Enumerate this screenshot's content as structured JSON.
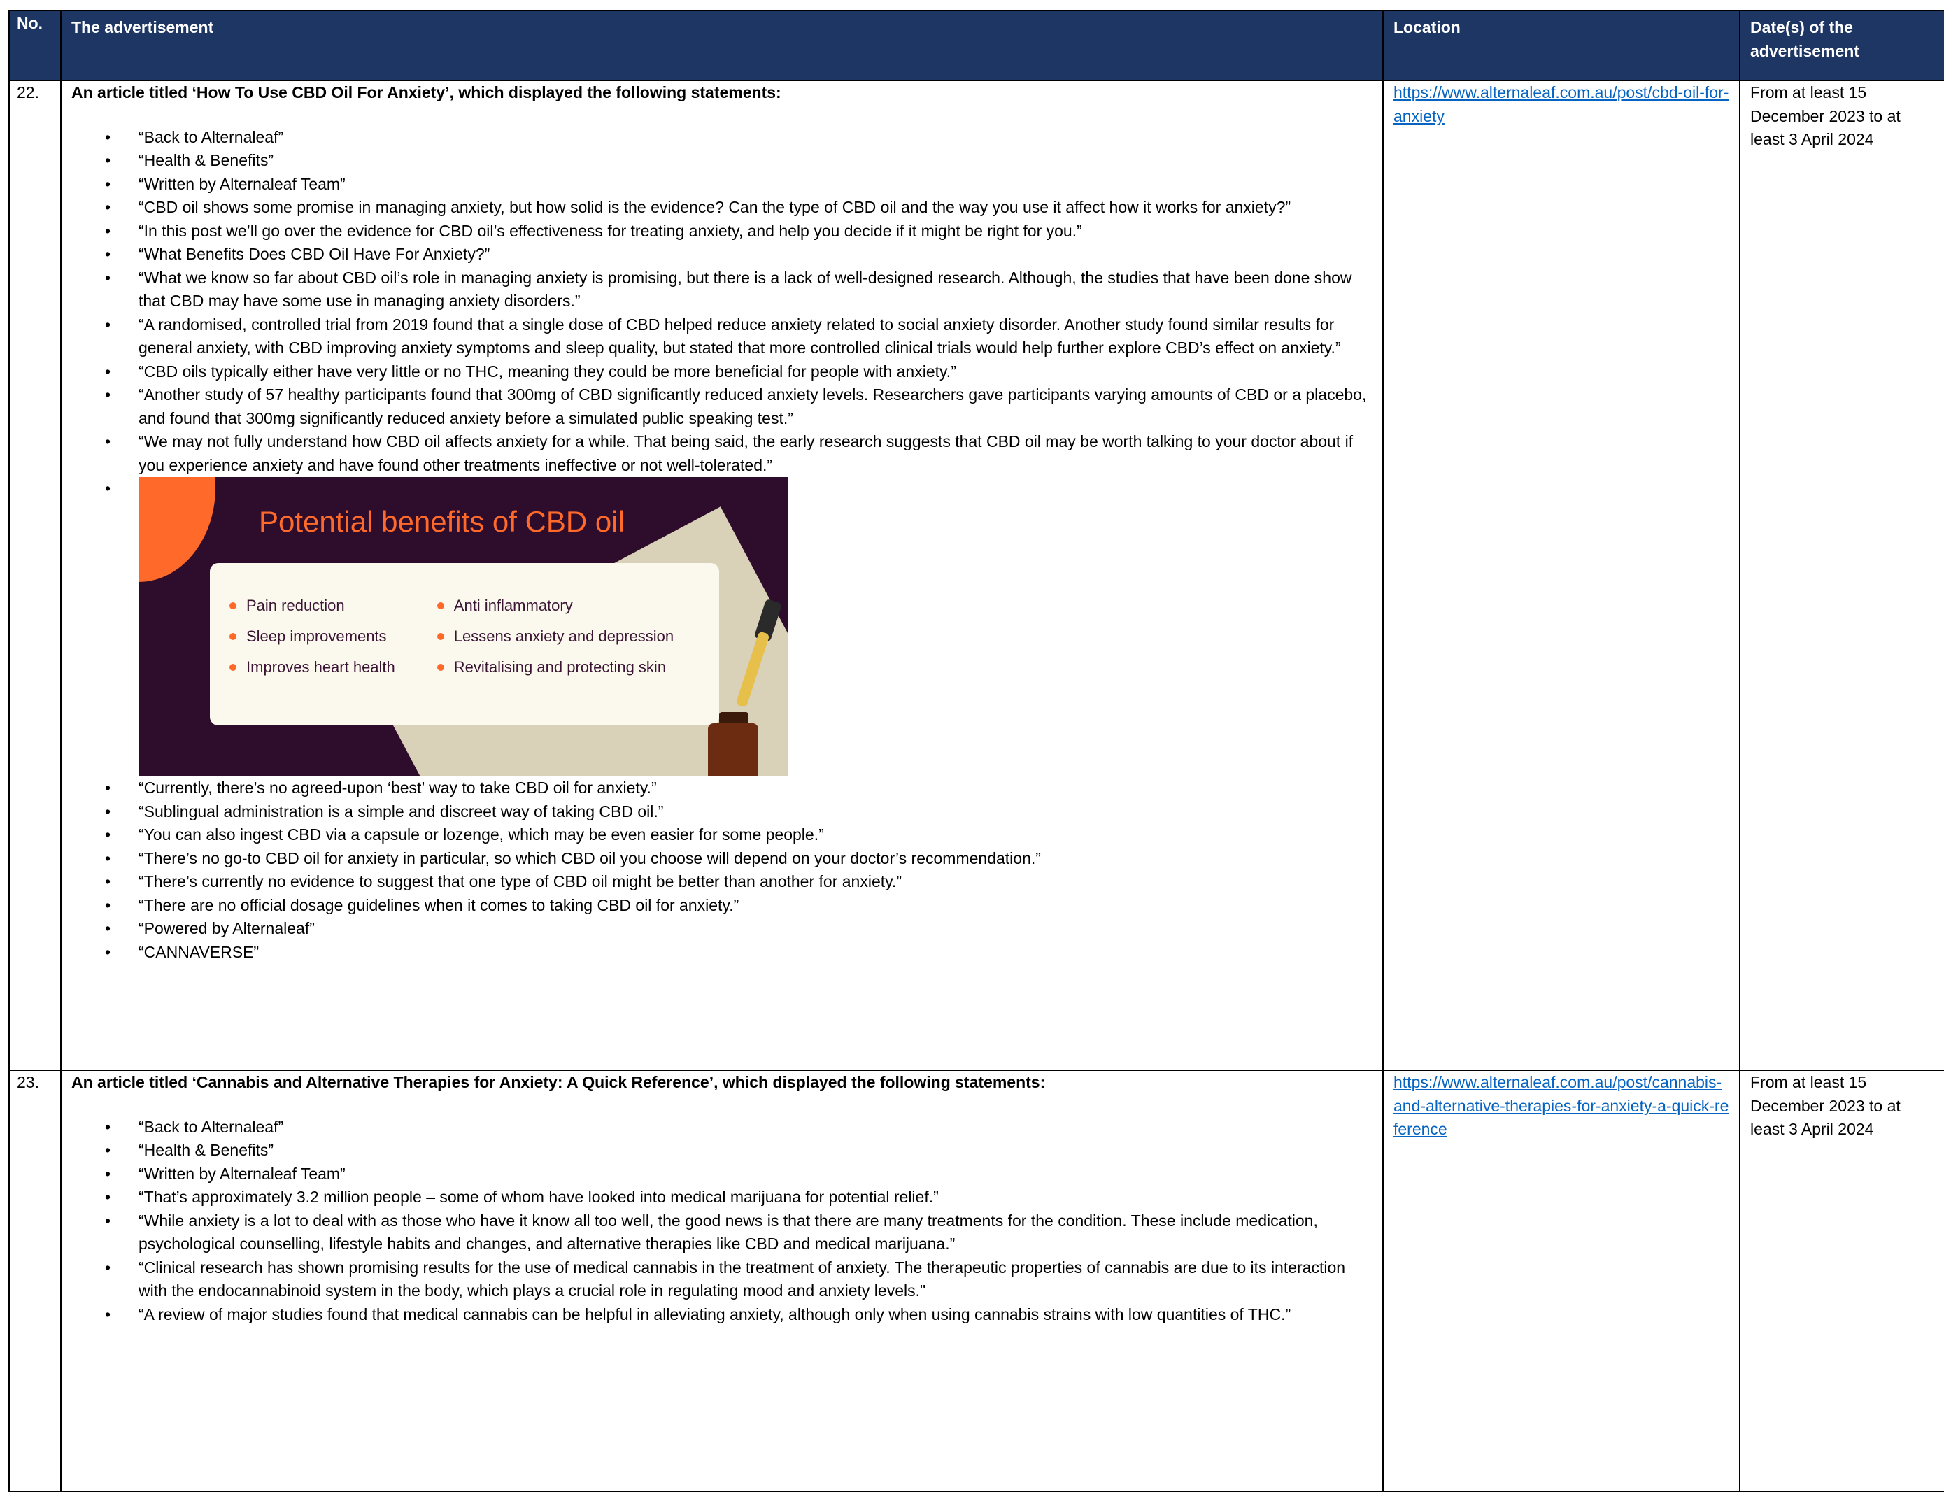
{
  "header": {
    "no": "No.",
    "advertisement": "The advertisement",
    "location": "Location",
    "dates": "Date(s) of the advertisement"
  },
  "rows": [
    {
      "no": "22.",
      "intro": "An article titled ‘How To Use CBD Oil For Anxiety’, which displayed the following statements:",
      "statements_before": [
        "“Back to Alternaleaf”",
        "“Health & Benefits”",
        "“Written by Alternaleaf Team”",
        "“CBD oil shows some promise in managing anxiety, but how solid is the evidence? Can the type of CBD oil and the way you use it affect how it works for anxiety?”",
        "“In this post we’ll go over the evidence for CBD oil’s effectiveness for treating anxiety, and help you decide if it might be right for you.”",
        "“What Benefits Does CBD Oil Have For Anxiety?”",
        "“What we know so far about CBD oil’s role in managing anxiety is promising, but there is a lack of well-designed research. Although, the studies that have been done show that CBD may have some use in managing anxiety disorders.”",
        "“A randomised, controlled trial from 2019 found that a single dose of CBD helped reduce anxiety related to social anxiety disorder. Another study found similar results for general anxiety, with CBD improving anxiety symptoms and sleep quality, but stated that more controlled clinical trials would help further explore CBD’s effect on anxiety.”",
        "“CBD oils typically either have very little or no THC, meaning they could be more beneficial for people with anxiety.”",
        "“Another study of 57 healthy participants found that 300mg of CBD significantly reduced anxiety levels. Researchers gave participants varying amounts of CBD or a placebo, and found that 300mg significantly reduced anxiety before a simulated public speaking test.”",
        "“We may not fully understand how CBD oil affects anxiety for a while. That being said, the early research suggests that CBD oil may be worth talking to your doctor about if you experience anxiety and have found other treatments ineffective or not well-tolerated.”"
      ],
      "image": {
        "title": "Potential benefits of CBD oil",
        "left_items": [
          "Pain reduction",
          "Sleep improvements",
          "Improves heart health"
        ],
        "right_items": [
          "Anti inflammatory",
          "Lessens anxiety and depression",
          "Revitalising and protecting skin"
        ],
        "colors": {
          "background": "#2e0c2c",
          "accent": "#ff6a2b",
          "card": "#fbf8ee"
        }
      },
      "statements_after": [
        "“Currently, there’s no agreed-upon ‘best’ way to take CBD oil for anxiety.”",
        "“Sublingual administration is a simple and discreet way of taking CBD oil.”",
        "“You can also ingest CBD via a capsule or lozenge, which may be even easier for some people.”",
        "“There’s no go-to CBD oil for anxiety in particular, so which CBD oil you choose will depend on your doctor’s recommendation.”",
        "“There’s currently no evidence to suggest that one type of CBD oil might be better than another for anxiety.”",
        "“There are no official dosage guidelines when it comes to taking CBD oil for anxiety.”",
        "“Powered by Alternaleaf”",
        "“CANNAVERSE”"
      ],
      "location": "https://www.alternaleaf.com.au/post/cbd-oil-for-anxiety",
      "dates": "From at least 15 December 2023 to at least 3 April 2024"
    },
    {
      "no": "23.",
      "intro": "An article titled ‘Cannabis and Alternative Therapies for Anxiety: A Quick Reference’, which displayed the following statements:",
      "statements_before": [
        "“Back to Alternaleaf”",
        "“Health & Benefits”",
        "“Written by Alternaleaf Team”",
        "“That’s approximately 3.2 million people – some of whom have looked into medical marijuana for potential relief.”",
        "“While anxiety is a lot to deal with as those who have it know all too well, the good news is that there are many treatments for the condition. These include medication, psychological counselling, lifestyle habits and changes, and alternative therapies like CBD and medical marijuana.”",
        "“Clinical research has shown promising results for the use of medical cannabis in the treatment of anxiety. The therapeutic properties of cannabis are due to its interaction with the endocannabinoid system in the body, which plays a crucial role in regulating mood and anxiety levels.\"",
        "“A review of major studies found that medical cannabis can be helpful in alleviating anxiety, although only when using cannabis strains with low quantities of THC.”"
      ],
      "location": "https://www.alternaleaf.com.au/post/cannabis-and-alternative-therapies-for-anxiety-a-quick-reference",
      "dates": "From at least 15 December 2023 to at least 3 April 2024"
    }
  ]
}
